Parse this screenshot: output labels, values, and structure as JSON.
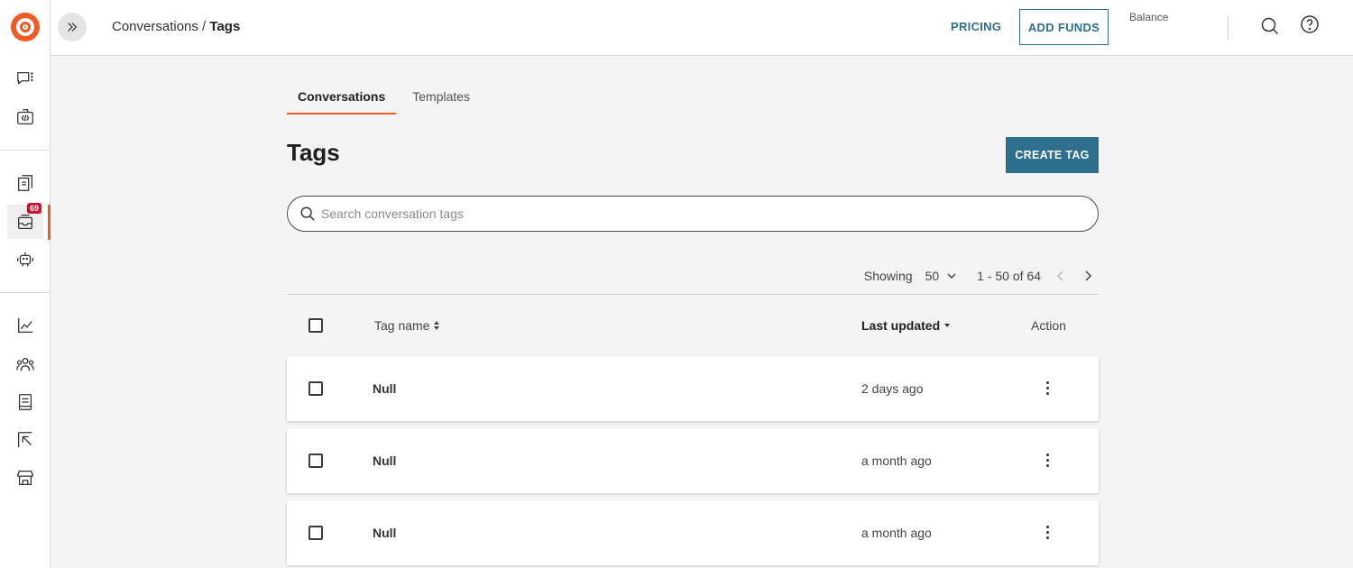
{
  "header": {
    "breadcrumb_parent": "Conversations",
    "breadcrumb_sep": " / ",
    "breadcrumb_current": "Tags",
    "pricing_label": "PRICING",
    "add_funds_label": "ADD FUNDS",
    "balance_label": "Balance"
  },
  "sidebar": {
    "badge_count": "69",
    "items": [
      "chat-icon",
      "code-icon",
      "docs-icon",
      "inbox-icon",
      "bot-icon",
      "analytics-icon",
      "users-icon",
      "book-icon",
      "cursor-icon",
      "store-icon"
    ]
  },
  "tabs": [
    {
      "label": "Conversations",
      "active": true
    },
    {
      "label": "Templates",
      "active": false
    }
  ],
  "page": {
    "title": "Tags",
    "create_label": "CREATE TAG",
    "search_placeholder": "Search conversation tags"
  },
  "pager": {
    "showing_label": "Showing",
    "page_size": "50",
    "range": "1 - 50 of 64"
  },
  "table": {
    "headers": {
      "tag_name": "Tag name",
      "last_updated": "Last updated",
      "action": "Action"
    },
    "rows": [
      {
        "tag": "Null",
        "updated": "2 days ago"
      },
      {
        "tag": "Null",
        "updated": "a month ago"
      },
      {
        "tag": "Null",
        "updated": "a month ago"
      }
    ]
  },
  "colors": {
    "accent": "#f15a24",
    "primary": "#2e6f8e",
    "badge": "#c8102e"
  }
}
